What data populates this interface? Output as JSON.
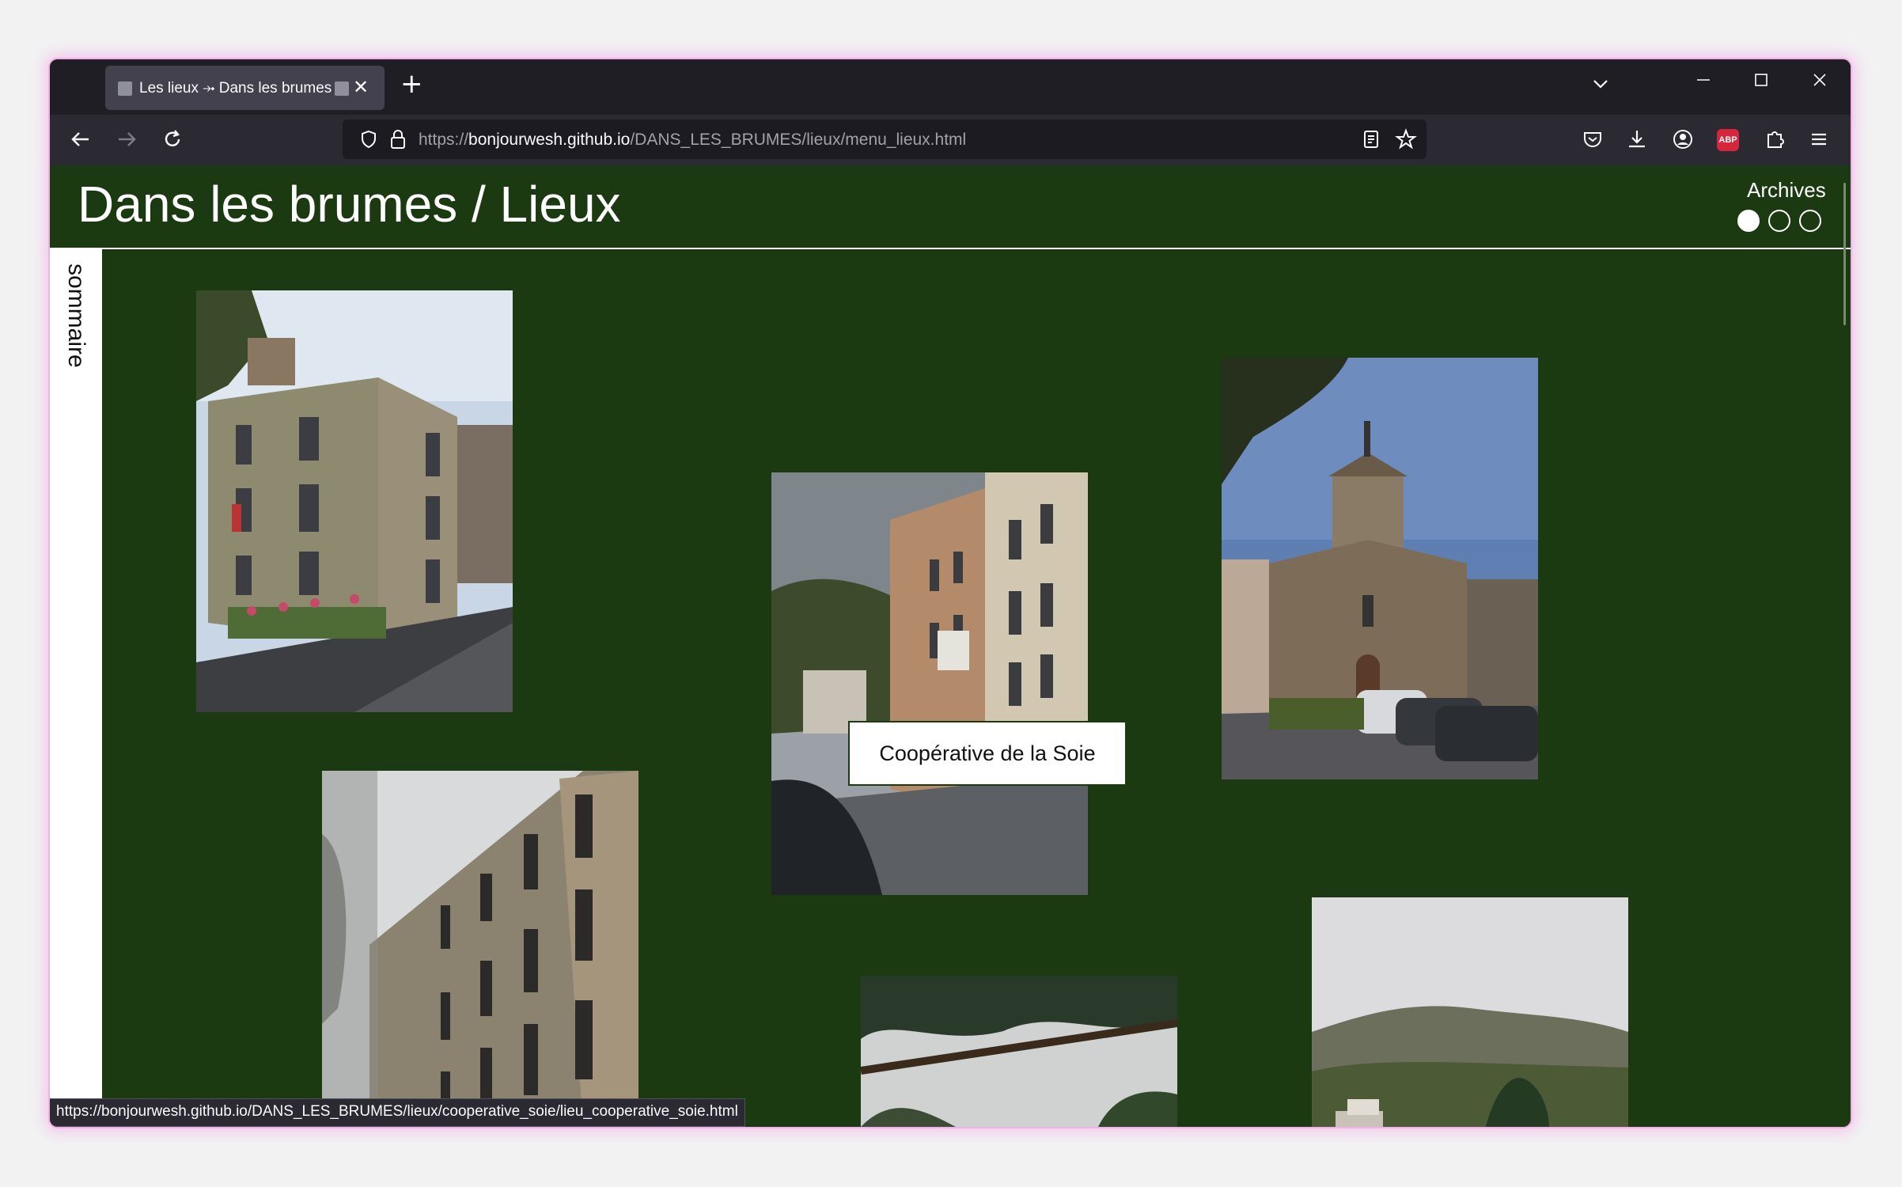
{
  "browser": {
    "tab_title": "Les lieux ⤞ Dans les brumes",
    "url_prefix": "https://",
    "url_domain": "bonjourwesh.github.io",
    "url_path": "/DANS_LES_BRUMES/lieux/menu_lieux.html",
    "status_url": "https://bonjourwesh.github.io/DANS_LES_BRUMES/lieux/cooperative_soie/lieu_cooperative_soie.html",
    "abp_label": "ABP"
  },
  "page": {
    "title": "Dans les brumes / Lieux",
    "archives_label": "Archives",
    "sidebar_label": "sommaire",
    "tooltip": "Coopérative de la Soie",
    "background_color": "#1c3a12"
  }
}
